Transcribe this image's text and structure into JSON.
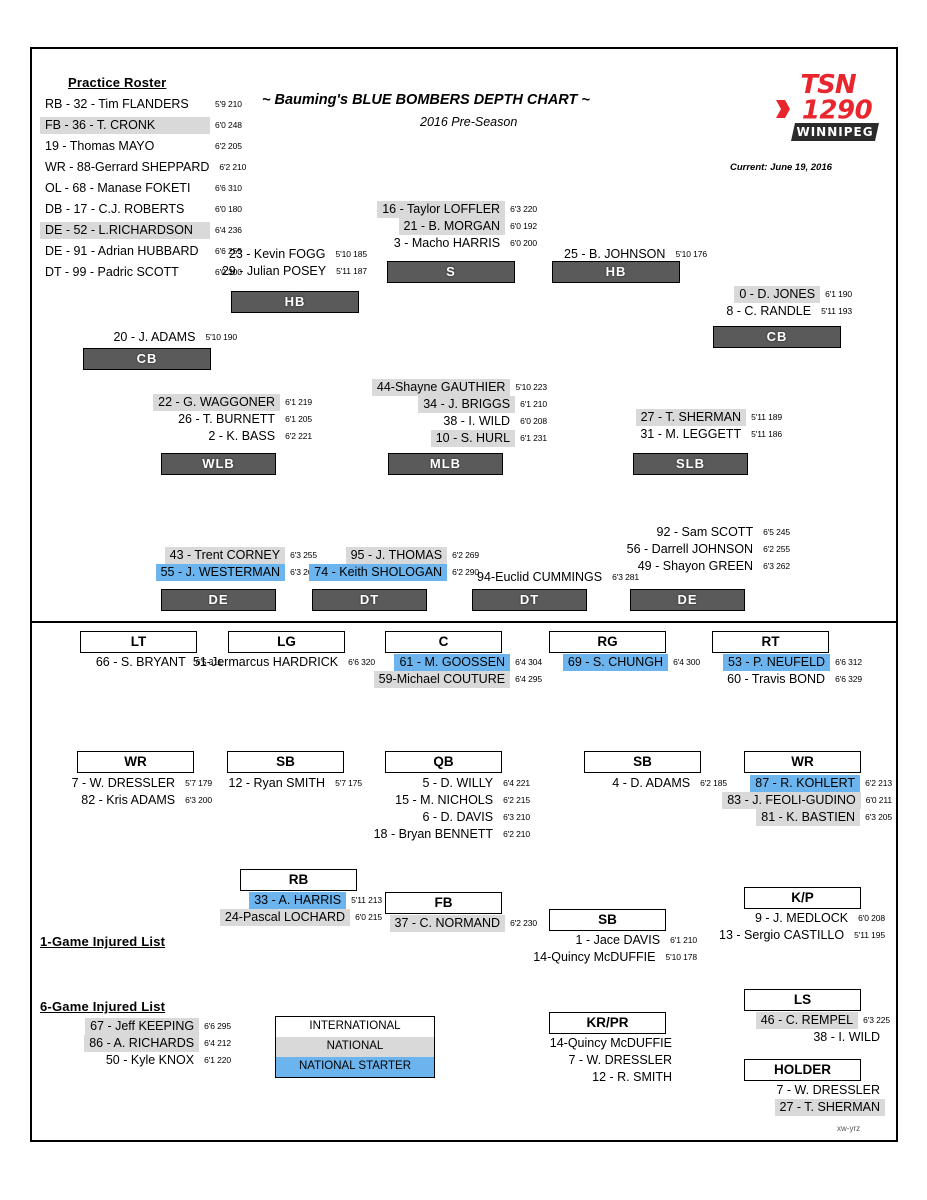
{
  "header": {
    "title": "~ Bauming's BLUE BOMBERS DEPTH CHART ~",
    "subtitle": "2016 Pre-Season",
    "date": "Current: June 19, 2016",
    "logo": {
      "top": "TSN",
      "mid": "1290",
      "bottom": "WINNIPEG"
    }
  },
  "corner_code": "xw-yrz",
  "practice_roster": {
    "title": "Practice Roster",
    "players": [
      {
        "name": "RB - 32 - Tim FLANDERS",
        "meas": "5'9 210",
        "tag": "i"
      },
      {
        "name": "FB - 36 - T. CRONK",
        "meas": "6'0 248",
        "tag": "n"
      },
      {
        "name": "19 - Thomas MAYO",
        "meas": "6'2 205",
        "tag": "i"
      },
      {
        "name": "WR - 88-Gerrard SHEPPARD",
        "meas": "6'2 210",
        "tag": "i"
      },
      {
        "name": "OL - 68 - Manase FOKETI",
        "meas": "6'6 310",
        "tag": "i"
      },
      {
        "name": "DB - 17 - C.J. ROBERTS",
        "meas": "6'0 180",
        "tag": "i"
      },
      {
        "name": "DE - 52 - L.RICHARDSON",
        "meas": "6'4 236",
        "tag": "n"
      },
      {
        "name": "DE - 91 - Adrian HUBBARD",
        "meas": "6'6 255",
        "tag": "i"
      },
      {
        "name": "DT - 99 - Padric SCOTT",
        "meas": "6'0 300",
        "tag": "i"
      }
    ]
  },
  "defense": {
    "hb_left": {
      "pos": "HB",
      "players": [
        {
          "name": "23 - Kevin FOGG",
          "meas": "5'10 185",
          "tag": "i"
        },
        {
          "name": "29 - Julian POSEY",
          "meas": "5'11 187",
          "tag": "i"
        }
      ]
    },
    "safety": {
      "pos": "S",
      "players": [
        {
          "name": "16 - Taylor LOFFLER",
          "meas": "6'3 220",
          "tag": "n"
        },
        {
          "name": "21 - B. MORGAN",
          "meas": "6'0 192",
          "tag": "n"
        },
        {
          "name": "3 - Macho HARRIS",
          "meas": "6'0 200",
          "tag": "i"
        }
      ]
    },
    "hb_right": {
      "pos": "HB",
      "players": [
        {
          "name": "25 - B. JOHNSON",
          "meas": "5'10 176",
          "tag": "i"
        }
      ]
    },
    "cb_left": {
      "pos": "CB",
      "players": [
        {
          "name": "20 - J. ADAMS",
          "meas": "5'10 190",
          "tag": "i"
        }
      ]
    },
    "cb_right": {
      "pos": "CB",
      "players": [
        {
          "name": "0 - D. JONES",
          "meas": "6'1 190",
          "tag": "n"
        },
        {
          "name": "8 - C. RANDLE",
          "meas": "5'11 193",
          "tag": "i"
        }
      ]
    },
    "wlb": {
      "pos": "WLB",
      "players": [
        {
          "name": "22 - G. WAGGONER",
          "meas": "6'1 219",
          "tag": "n"
        },
        {
          "name": "26 - T. BURNETT",
          "meas": "6'1 205",
          "tag": "i"
        },
        {
          "name": "2 - K. BASS",
          "meas": "6'2 221",
          "tag": "i"
        }
      ]
    },
    "mlb": {
      "pos": "MLB",
      "players": [
        {
          "name": "44-Shayne GAUTHIER",
          "meas": "5'10 223",
          "tag": "n"
        },
        {
          "name": "34 - J. BRIGGS",
          "meas": "6'1 210",
          "tag": "n"
        },
        {
          "name": "38 - I. WILD",
          "meas": "6'0 208",
          "tag": "i"
        },
        {
          "name": "10 - S. HURL",
          "meas": "6'1 231",
          "tag": "n"
        }
      ]
    },
    "slb": {
      "pos": "SLB",
      "players": [
        {
          "name": "27 - T. SHERMAN",
          "meas": "5'11 189",
          "tag": "n"
        },
        {
          "name": "31 - M. LEGGETT",
          "meas": "5'11 186",
          "tag": "i"
        }
      ]
    },
    "de_left": {
      "pos": "DE",
      "players": [
        {
          "name": "43 - Trent CORNEY",
          "meas": "6'3 255",
          "tag": "n"
        },
        {
          "name": "55 - J. WESTERMAN",
          "meas": "6'3 260",
          "tag": "ns"
        }
      ]
    },
    "dt_left": {
      "pos": "DT",
      "players": [
        {
          "name": "95 - J. THOMAS",
          "meas": "6'2 269",
          "tag": "n"
        },
        {
          "name": "74 - Keith SHOLOGAN",
          "meas": "6'2 290",
          "tag": "ns"
        }
      ]
    },
    "dt_right": {
      "pos": "DT",
      "players": [
        {
          "name": "94-Euclid CUMMINGS",
          "meas": "6'3 281",
          "tag": "i"
        }
      ]
    },
    "de_right": {
      "pos": "DE",
      "players": [
        {
          "name": "92 - Sam SCOTT",
          "meas": "6'5 245",
          "tag": "i"
        },
        {
          "name": "56 - Darrell JOHNSON",
          "meas": "6'2 255",
          "tag": "i"
        },
        {
          "name": "49 - Shayon GREEN",
          "meas": "6'3 262",
          "tag": "i"
        }
      ]
    }
  },
  "offense": {
    "lt": {
      "pos": "LT",
      "players": [
        {
          "name": "66 - S. BRYANT",
          "meas": "6'5 311",
          "tag": "i"
        }
      ]
    },
    "lg": {
      "pos": "LG",
      "players": [
        {
          "name": "51-Jermarcus HARDRICK",
          "meas": "6'6 320",
          "tag": "i"
        }
      ]
    },
    "c": {
      "pos": "C",
      "players": [
        {
          "name": "61 - M. GOOSSEN",
          "meas": "6'4 304",
          "tag": "ns"
        },
        {
          "name": "59-Michael COUTURE",
          "meas": "6'4 295",
          "tag": "n"
        }
      ]
    },
    "rg": {
      "pos": "RG",
      "players": [
        {
          "name": "69 - S. CHUNGH",
          "meas": "6'4 300",
          "tag": "ns"
        }
      ]
    },
    "rt": {
      "pos": "RT",
      "players": [
        {
          "name": "53 - P. NEUFELD",
          "meas": "6'6 312",
          "tag": "ns"
        },
        {
          "name": "60 - Travis BOND",
          "meas": "6'6 329",
          "tag": "i"
        }
      ]
    },
    "wr_left": {
      "pos": "WR",
      "players": [
        {
          "name": "7 - W. DRESSLER",
          "meas": "5'7 179",
          "tag": "i"
        },
        {
          "name": "82 - Kris ADAMS",
          "meas": "6'3 200",
          "tag": "i"
        }
      ]
    },
    "sb_left": {
      "pos": "SB",
      "players": [
        {
          "name": "12 - Ryan SMITH",
          "meas": "5'7 175",
          "tag": "i"
        }
      ]
    },
    "qb": {
      "pos": "QB",
      "players": [
        {
          "name": "5 - D. WILLY",
          "meas": "6'4 221",
          "tag": "i"
        },
        {
          "name": "15 - M. NICHOLS",
          "meas": "6'2 215",
          "tag": "i"
        },
        {
          "name": "6 - D. DAVIS",
          "meas": "6'3 210",
          "tag": "i"
        },
        {
          "name": "18 - Bryan BENNETT",
          "meas": "6'2 210",
          "tag": "i"
        }
      ]
    },
    "sb_mid": {
      "pos": "SB",
      "players": [
        {
          "name": "4 - D. ADAMS",
          "meas": "6'2 185",
          "tag": "i"
        }
      ]
    },
    "wr_right": {
      "pos": "WR",
      "players": [
        {
          "name": "87 - R. KOHLERT",
          "meas": "6'2 213",
          "tag": "ns"
        },
        {
          "name": "83 - J. FEOLI-GUDINO",
          "meas": "6'0 211",
          "tag": "n"
        },
        {
          "name": "81 - K. BASTIEN",
          "meas": "6'3 205",
          "tag": "n"
        }
      ]
    },
    "rb": {
      "pos": "RB",
      "players": [
        {
          "name": "33 - A. HARRIS",
          "meas": "5'11 213",
          "tag": "ns"
        },
        {
          "name": "24-Pascal LOCHARD",
          "meas": "6'0 215",
          "tag": "n"
        }
      ]
    },
    "fb": {
      "pos": "FB",
      "players": [
        {
          "name": "37 - C. NORMAND",
          "meas": "6'2 230",
          "tag": "n"
        }
      ]
    },
    "sb_bottom": {
      "pos": "SB",
      "players": [
        {
          "name": "1 - Jace DAVIS",
          "meas": "6'1 210",
          "tag": "i"
        },
        {
          "name": "14-Quincy McDUFFIE",
          "meas": "5'10 178",
          "tag": "i"
        }
      ]
    },
    "kp": {
      "pos": "K/P",
      "players": [
        {
          "name": "9 - J. MEDLOCK",
          "meas": "6'0 208",
          "tag": "i"
        },
        {
          "name": "13 - Sergio CASTILLO",
          "meas": "5'11 195",
          "tag": "i"
        }
      ]
    },
    "ls": {
      "pos": "LS",
      "players": [
        {
          "name": "46 - C. REMPEL",
          "meas": "6'3 225",
          "tag": "n"
        },
        {
          "name": "38 - I. WILD",
          "meas": "",
          "tag": "i"
        }
      ]
    },
    "holder": {
      "pos": "HOLDER",
      "players": [
        {
          "name": "7 - W. DRESSLER",
          "meas": "",
          "tag": "i"
        },
        {
          "name": "27 - T. SHERMAN",
          "meas": "",
          "tag": "n"
        }
      ]
    },
    "krpr": {
      "pos": "KR/PR",
      "players": [
        {
          "name": "14-Quincy McDUFFIE",
          "meas": "",
          "tag": "i"
        },
        {
          "name": "7 - W. DRESSLER",
          "meas": "",
          "tag": "i"
        },
        {
          "name": "12 - R. SMITH",
          "meas": "",
          "tag": "i"
        }
      ]
    }
  },
  "injured": {
    "one_game": {
      "title": "1-Game Injured List",
      "players": []
    },
    "six_game": {
      "title": "6-Game Injured List",
      "players": [
        {
          "name": "67 - Jeff KEEPING",
          "meas": "6'6 295",
          "tag": "n"
        },
        {
          "name": "86 - A. RICHARDS",
          "meas": "6'4 212",
          "tag": "n"
        },
        {
          "name": "50 - Kyle KNOX",
          "meas": "6'1 220",
          "tag": "i"
        }
      ]
    }
  },
  "legend": {
    "rows": [
      {
        "label": "INTERNATIONAL",
        "tag": "i"
      },
      {
        "label": "NATIONAL",
        "tag": "n"
      },
      {
        "label": "NATIONAL STARTER",
        "tag": "ns"
      }
    ]
  },
  "colors": {
    "international": "#ffffff",
    "national": "#d9d9d9",
    "national_starter": "#6cb4ee",
    "position_box": "#5a5a5a",
    "logo_red": "#e8262e"
  }
}
